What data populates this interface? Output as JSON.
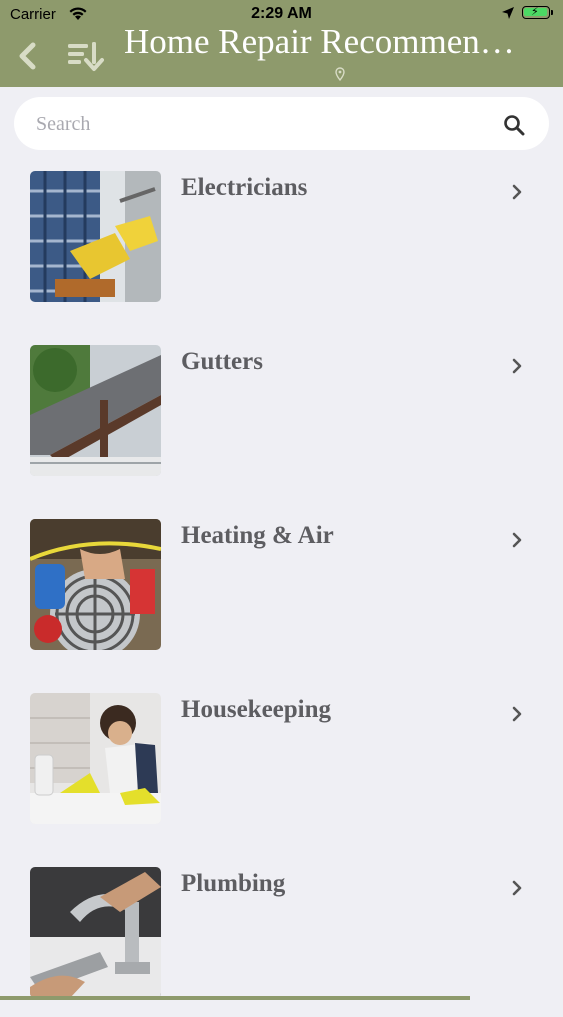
{
  "status_bar": {
    "carrier": "Carrier",
    "time": "2:29 AM"
  },
  "nav": {
    "title": "Home Repair Recommen…"
  },
  "search": {
    "placeholder": "Search"
  },
  "colors": {
    "nav_bg": "#8e9a6c",
    "label": "#5d5d61",
    "background": "#efeff4"
  },
  "categories": [
    {
      "label": "Electricians"
    },
    {
      "label": "Gutters"
    },
    {
      "label": "Heating & Air"
    },
    {
      "label": "Housekeeping"
    },
    {
      "label": "Plumbing"
    }
  ]
}
